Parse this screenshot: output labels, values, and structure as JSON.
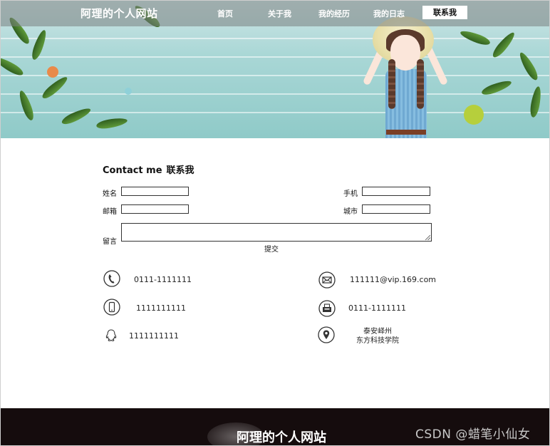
{
  "header": {
    "brand": "阿理的个人网站",
    "nav": [
      {
        "label": "首页"
      },
      {
        "label": "关于我"
      },
      {
        "label": "我的经历"
      },
      {
        "label": "我的日志"
      },
      {
        "label": "联系我",
        "active": true
      }
    ]
  },
  "contact": {
    "title_en": "Contact me",
    "title_cn": "联系我",
    "form": {
      "name_label": "姓名",
      "phone_label": "手机",
      "email_label": "邮箱",
      "city_label": "城市",
      "message_label": "留言",
      "submit_label": "提交"
    },
    "info": {
      "telephone": "0111-1111111",
      "email": "111111@vip.169.com",
      "mobile": "1111111111",
      "fax": "0111-1111111",
      "qq": "1111111111",
      "address_line1": "泰安峄州",
      "address_line2": "东方科技学院"
    }
  },
  "footer": {
    "brand": "阿理的个人网站"
  },
  "watermark": "CSDN @蜡笔小仙女",
  "colors": {
    "nav_bg": "#7a8080",
    "footer_bg": "#150c0d",
    "banner_wood": "#a9d7d6"
  }
}
